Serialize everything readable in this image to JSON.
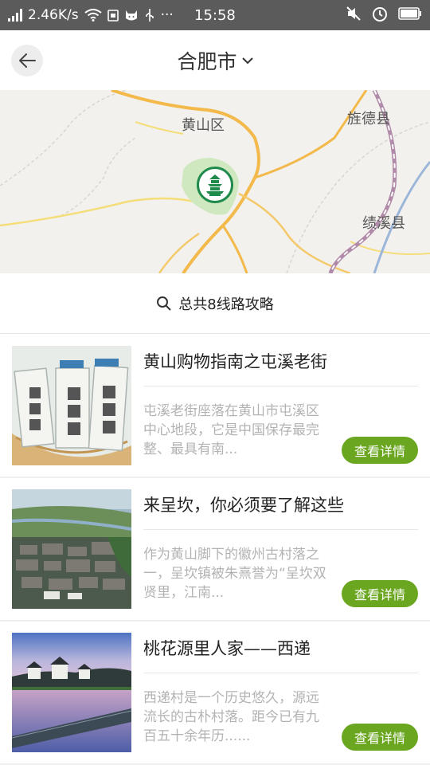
{
  "status": {
    "speed": "2.46K/s",
    "time": "15:58",
    "dots": "···"
  },
  "header": {
    "title": "合肥市",
    "back_icon": "arrow-left-icon",
    "dropdown_icon": "chevron-down-icon"
  },
  "map": {
    "labels": {
      "huangshan": "黄山区",
      "jingde": "旌德县",
      "jixi": "绩溪县"
    },
    "marker_icon": "pagoda-marker-icon"
  },
  "search": {
    "summary": "总共8线路攻略",
    "icon": "search-icon"
  },
  "routes": [
    {
      "title": "黄山购物指南之屯溪老街",
      "desc": "屯溪老街座落在黄山市屯溪区中心地段，它是中国保存最完整、最具有南...",
      "button": "查看详情"
    },
    {
      "title": "来呈坎，你必须要了解这些",
      "desc": "作为黄山脚下的徽州古村落之一，呈坎镇被朱熹誉为“呈坎双贤里，江南...",
      "button": "查看详情"
    },
    {
      "title": "桃花源里人家——西递",
      "desc": "西递村是一个历史悠久，源远流长的古朴村落。距今已有九百五十余年历......",
      "button": "查看详情"
    }
  ],
  "colors": {
    "accent": "#6aa61f",
    "status_bar": "#5b5b5b",
    "map_bg": "#f2f1ee"
  }
}
